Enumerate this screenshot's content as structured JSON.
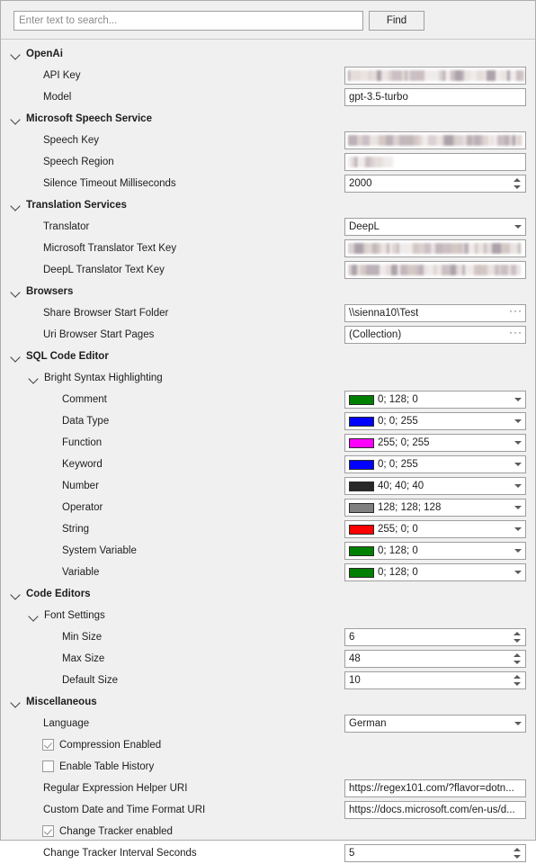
{
  "search": {
    "placeholder": "Enter text to search...",
    "value": "",
    "find_label": "Find"
  },
  "grid": {
    "rows": [
      {
        "kind": "category",
        "level": 0,
        "label": "OpenAi",
        "expanded": true
      },
      {
        "kind": "property",
        "level": 0,
        "label": "API Key",
        "control": "redacted",
        "redact_width": 196
      },
      {
        "kind": "property",
        "level": 0,
        "label": "Model",
        "control": "text",
        "value": "gpt-3.5-turbo"
      },
      {
        "kind": "category",
        "level": 0,
        "label": "Microsoft Speech Service",
        "expanded": true
      },
      {
        "kind": "property",
        "level": 0,
        "label": "Speech Key",
        "control": "redacted",
        "redact_width": 194
      },
      {
        "kind": "property",
        "level": 0,
        "label": "Speech Region",
        "control": "redacted",
        "redact_width": 50
      },
      {
        "kind": "property",
        "level": 0,
        "label": "Silence Timeout Milliseconds",
        "control": "spinner",
        "value": "2000"
      },
      {
        "kind": "category",
        "level": 0,
        "label": "Translation Services",
        "expanded": true
      },
      {
        "kind": "property",
        "level": 0,
        "label": "Translator",
        "control": "combo",
        "value": "DeepL"
      },
      {
        "kind": "property",
        "level": 0,
        "label": "Microsoft Translator Text Key",
        "control": "redacted",
        "redact_width": 192
      },
      {
        "kind": "property",
        "level": 0,
        "label": "DeepL Translator Text Key",
        "control": "redacted",
        "redact_width": 192
      },
      {
        "kind": "category",
        "level": 0,
        "label": "Browsers",
        "expanded": true
      },
      {
        "kind": "property",
        "level": 0,
        "label": "Share Browser Start Folder",
        "control": "ellipsis",
        "value": "\\\\sienna10\\Test"
      },
      {
        "kind": "property",
        "level": 0,
        "label": "Uri Browser Start Pages",
        "control": "ellipsis",
        "value": "(Collection)"
      },
      {
        "kind": "category",
        "level": 0,
        "label": "SQL Code Editor",
        "expanded": true
      },
      {
        "kind": "subcategory",
        "level": 1,
        "label": "Bright Syntax Highlighting",
        "expanded": true
      },
      {
        "kind": "property",
        "level": 1,
        "label": "Comment",
        "control": "color",
        "value": "0; 128; 0",
        "color": "#008000"
      },
      {
        "kind": "property",
        "level": 1,
        "label": "Data Type",
        "control": "color",
        "value": "0; 0; 255",
        "color": "#0000ff"
      },
      {
        "kind": "property",
        "level": 1,
        "label": "Function",
        "control": "color",
        "value": "255; 0; 255",
        "color": "#ff00ff"
      },
      {
        "kind": "property",
        "level": 1,
        "label": "Keyword",
        "control": "color",
        "value": "0; 0; 255",
        "color": "#0000ff"
      },
      {
        "kind": "property",
        "level": 1,
        "label": "Number",
        "control": "color",
        "value": "40; 40; 40",
        "color": "#282828"
      },
      {
        "kind": "property",
        "level": 1,
        "label": "Operator",
        "control": "color",
        "value": "128; 128; 128",
        "color": "#808080"
      },
      {
        "kind": "property",
        "level": 1,
        "label": "String",
        "control": "color",
        "value": "255; 0; 0",
        "color": "#ff0000"
      },
      {
        "kind": "property",
        "level": 1,
        "label": "System Variable",
        "control": "color",
        "value": "0; 128; 0",
        "color": "#008000"
      },
      {
        "kind": "property",
        "level": 1,
        "label": "Variable",
        "control": "color",
        "value": "0; 128; 0",
        "color": "#008000"
      },
      {
        "kind": "category",
        "level": 0,
        "label": "Code Editors",
        "expanded": true
      },
      {
        "kind": "subcategory",
        "level": 1,
        "label": "Font Settings",
        "expanded": true
      },
      {
        "kind": "property",
        "level": 1,
        "label": "Min Size",
        "control": "spinner",
        "value": "6"
      },
      {
        "kind": "property",
        "level": 1,
        "label": "Max Size",
        "control": "spinner",
        "value": "48"
      },
      {
        "kind": "property",
        "level": 1,
        "label": "Default Size",
        "control": "spinner",
        "value": "10"
      },
      {
        "kind": "category",
        "level": 0,
        "label": "Miscellaneous",
        "expanded": true
      },
      {
        "kind": "property",
        "level": 0,
        "label": "Language",
        "control": "combo",
        "value": "German"
      },
      {
        "kind": "checkbox",
        "level": 0,
        "label": "Compression Enabled",
        "checked": true
      },
      {
        "kind": "checkbox",
        "level": 0,
        "label": "Enable Table History",
        "checked": false
      },
      {
        "kind": "property",
        "level": 0,
        "label": "Regular Expression Helper URI",
        "control": "text",
        "value": "https://regex101.com/?flavor=dotn..."
      },
      {
        "kind": "property",
        "level": 0,
        "label": "Custom Date and Time Format URI",
        "control": "text",
        "value": "https://docs.microsoft.com/en-us/d..."
      },
      {
        "kind": "checkbox",
        "level": 0,
        "label": "Change Tracker enabled",
        "checked": true
      },
      {
        "kind": "property",
        "level": 0,
        "label": "Change Tracker Interval Seconds",
        "control": "spinner",
        "value": "5"
      }
    ]
  }
}
